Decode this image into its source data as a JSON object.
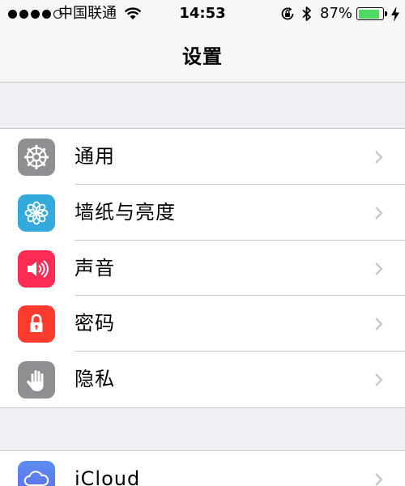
{
  "status_bar": {
    "carrier": "中国联通",
    "time": "14:53",
    "battery_percent": "87%",
    "battery_level": 0.87,
    "signal_bars_filled": 4,
    "signal_bars_total": 5,
    "icons": [
      "wifi-icon",
      "rotation-lock-icon",
      "bluetooth-icon",
      "battery-icon",
      "charging-icon"
    ]
  },
  "nav": {
    "title": "设置"
  },
  "groups": [
    {
      "items": [
        {
          "label": "通用",
          "icon": "gear-icon",
          "color": "#8e8e93"
        },
        {
          "label": "墙纸与亮度",
          "icon": "flower-icon",
          "color": "#34aadc"
        },
        {
          "label": "声音",
          "icon": "speaker-icon",
          "color": "#ff2d55"
        },
        {
          "label": "密码",
          "icon": "lock-icon",
          "color": "#ff3b30"
        },
        {
          "label": "隐私",
          "icon": "hand-icon",
          "color": "#8e8e93"
        }
      ]
    },
    {
      "items": [
        {
          "label": "iCloud",
          "icon": "cloud-icon",
          "color": "#5e6ee8"
        }
      ]
    }
  ]
}
